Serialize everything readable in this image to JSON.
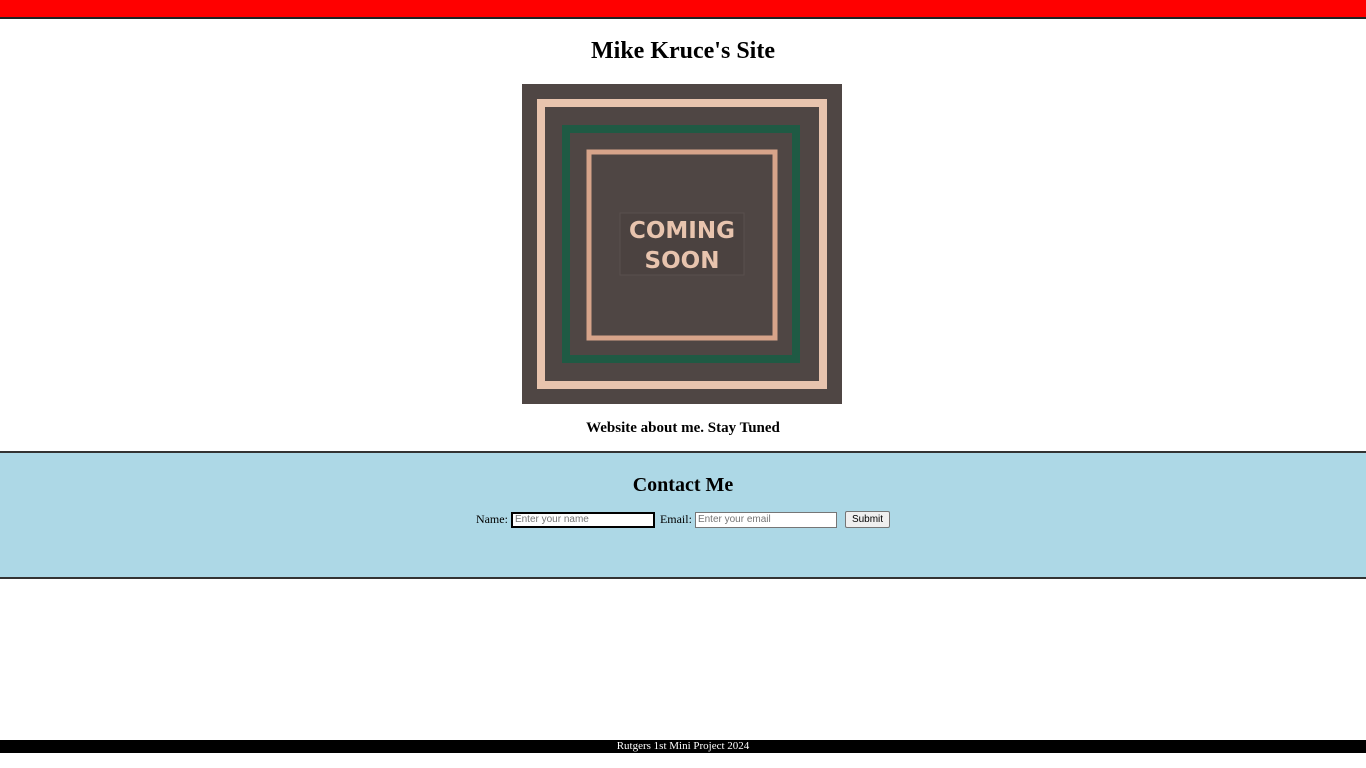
{
  "header": {
    "title": "Mike Kruce's Site"
  },
  "hero": {
    "line1": "COMING",
    "line2": "SOON",
    "colors": {
      "background": "#4f4644",
      "outer_frame": "#e8c4ae",
      "middle_frame": "#1f5a44",
      "inner_frame": "#d7a48a"
    }
  },
  "tagline": "Website about me. Stay Tuned",
  "contact": {
    "title": "Contact Me",
    "name_label": "Name:",
    "name_placeholder": "Enter your name",
    "email_label": "Email:",
    "email_placeholder": "Enter your email",
    "submit_label": "Submit",
    "background": "#add8e6"
  },
  "footer": {
    "text": "Rutgers 1st Mini Project 2024"
  },
  "colors": {
    "top_bar": "#ff0000",
    "footer_bg": "#000000"
  }
}
